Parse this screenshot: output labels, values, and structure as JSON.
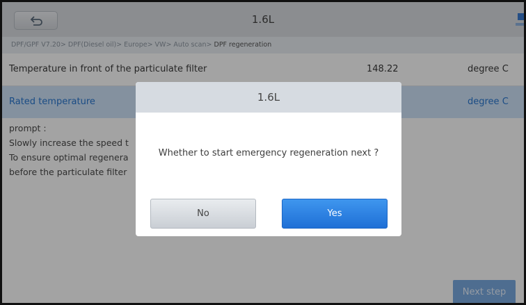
{
  "header": {
    "title": "1.6L",
    "back_icon": "back-arrow-icon",
    "corner_icon": "save-icon"
  },
  "breadcrumb": {
    "path": "DPF/GPF V7.20> DPF(Diesel oil)> Europe> VW> Auto scan> ",
    "current": "DPF regeneration"
  },
  "table": {
    "rows": [
      {
        "name": "Temperature in front of the particulate filter",
        "value": "148.22",
        "unit": "degree C"
      },
      {
        "name": "Rated temperature",
        "value": "",
        "unit": "degree C"
      }
    ]
  },
  "prompt": {
    "lines": [
      "prompt :",
      "Slowly increase the speed t",
      "To ensure optimal regenera",
      "before the particulate filter"
    ]
  },
  "footer": {
    "next_label": "Next step"
  },
  "dialog": {
    "title": "1.6L",
    "message": "Whether to start emergency regeneration next ?",
    "no_label": "No",
    "yes_label": "Yes"
  },
  "colors": {
    "accent": "#2a78d0",
    "highlight_row": "#cfe3f9",
    "yes_button": "#2e84e4"
  }
}
